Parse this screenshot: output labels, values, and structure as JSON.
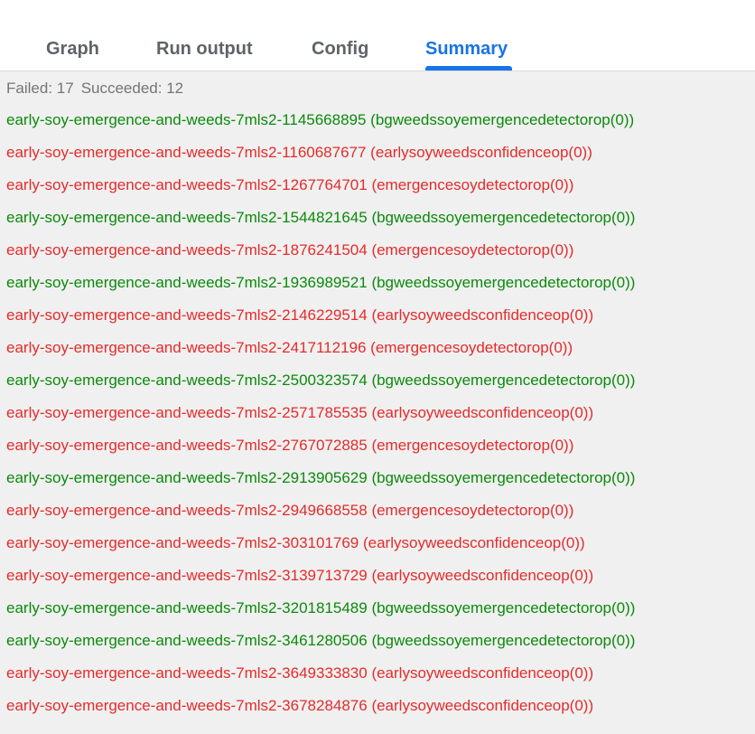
{
  "tabs": [
    {
      "label": "Graph",
      "active": false
    },
    {
      "label": "Run output",
      "active": false
    },
    {
      "label": "Config",
      "active": false
    },
    {
      "label": "Summary",
      "active": true
    }
  ],
  "summary": {
    "failed_label": "Failed:",
    "failed_count": "17",
    "succeeded_label": "Succeeded:",
    "succeeded_count": "12"
  },
  "colors": {
    "accent": "#1a73e8",
    "succeeded": "#0b8a0b",
    "failed": "#e52b2b",
    "muted": "#757575"
  },
  "runs": [
    {
      "text": "early-soy-emergence-and-weeds-7mls2-1145668895 (bgweedssoyemergencedetectorop(0))",
      "status": "succeeded"
    },
    {
      "text": "early-soy-emergence-and-weeds-7mls2-1160687677 (earlysoyweedsconfidenceop(0))",
      "status": "failed"
    },
    {
      "text": "early-soy-emergence-and-weeds-7mls2-1267764701 (emergencesoydetectorop(0))",
      "status": "failed"
    },
    {
      "text": "early-soy-emergence-and-weeds-7mls2-1544821645 (bgweedssoyemergencedetectorop(0))",
      "status": "succeeded"
    },
    {
      "text": "early-soy-emergence-and-weeds-7mls2-1876241504 (emergencesoydetectorop(0))",
      "status": "failed"
    },
    {
      "text": "early-soy-emergence-and-weeds-7mls2-1936989521 (bgweedssoyemergencedetectorop(0))",
      "status": "succeeded"
    },
    {
      "text": "early-soy-emergence-and-weeds-7mls2-2146229514 (earlysoyweedsconfidenceop(0))",
      "status": "failed"
    },
    {
      "text": "early-soy-emergence-and-weeds-7mls2-2417112196 (emergencesoydetectorop(0))",
      "status": "failed"
    },
    {
      "text": "early-soy-emergence-and-weeds-7mls2-2500323574 (bgweedssoyemergencedetectorop(0))",
      "status": "succeeded"
    },
    {
      "text": "early-soy-emergence-and-weeds-7mls2-2571785535 (earlysoyweedsconfidenceop(0))",
      "status": "failed"
    },
    {
      "text": "early-soy-emergence-and-weeds-7mls2-2767072885 (emergencesoydetectorop(0))",
      "status": "failed"
    },
    {
      "text": "early-soy-emergence-and-weeds-7mls2-2913905629 (bgweedssoyemergencedetectorop(0))",
      "status": "succeeded"
    },
    {
      "text": "early-soy-emergence-and-weeds-7mls2-2949668558 (emergencesoydetectorop(0))",
      "status": "failed"
    },
    {
      "text": "early-soy-emergence-and-weeds-7mls2-303101769 (earlysoyweedsconfidenceop(0))",
      "status": "failed"
    },
    {
      "text": "early-soy-emergence-and-weeds-7mls2-3139713729 (earlysoyweedsconfidenceop(0))",
      "status": "failed"
    },
    {
      "text": "early-soy-emergence-and-weeds-7mls2-3201815489 (bgweedssoyemergencedetectorop(0))",
      "status": "succeeded"
    },
    {
      "text": "early-soy-emergence-and-weeds-7mls2-3461280506 (bgweedssoyemergencedetectorop(0))",
      "status": "succeeded"
    },
    {
      "text": "early-soy-emergence-and-weeds-7mls2-3649333830 (earlysoyweedsconfidenceop(0))",
      "status": "failed"
    },
    {
      "text": "early-soy-emergence-and-weeds-7mls2-3678284876 (earlysoyweedsconfidenceop(0))",
      "status": "failed"
    }
  ]
}
